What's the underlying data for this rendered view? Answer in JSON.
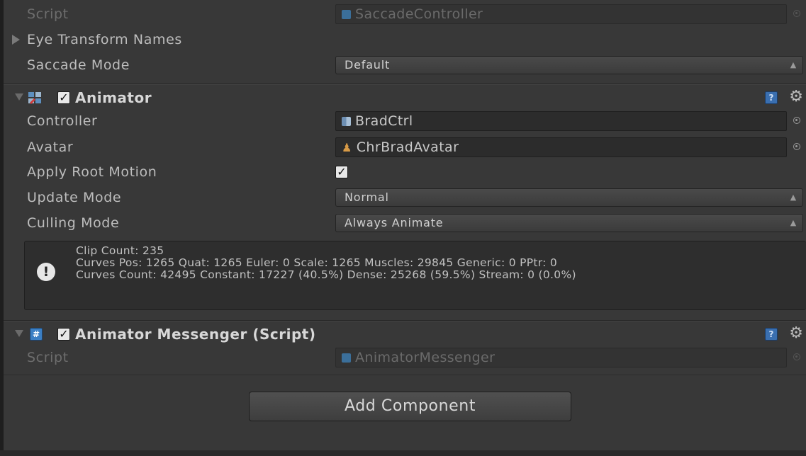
{
  "top_component": {
    "script_label": "Script",
    "script_value": "SaccadeController",
    "eye_transform_names_label": "Eye Transform Names",
    "saccade_mode_label": "Saccade Mode",
    "saccade_mode_value": "Default"
  },
  "animator": {
    "title": "Animator",
    "enabled": true,
    "controller_label": "Controller",
    "controller_value": "BradCtrl",
    "avatar_label": "Avatar",
    "avatar_value": "ChrBradAvatar",
    "apply_root_motion_label": "Apply Root Motion",
    "apply_root_motion_checked": true,
    "update_mode_label": "Update Mode",
    "update_mode_value": "Normal",
    "culling_mode_label": "Culling Mode",
    "culling_mode_value": "Always Animate",
    "info_lines": [
      "Clip Count: 235",
      "Curves Pos: 1265 Quat: 1265 Euler: 0 Scale: 1265 Muscles: 29845 Generic: 0 PPtr: 0",
      "Curves Count: 42495 Constant: 17227 (40.5%) Dense: 25268 (59.5%) Stream: 0 (0.0%)"
    ]
  },
  "messenger": {
    "title": "Animator Messenger (Script)",
    "enabled": true,
    "script_label": "Script",
    "script_value": "AnimatorMessenger"
  },
  "add_component_label": "Add Component",
  "icons": {
    "script_file": "script-file-icon",
    "controller": "animator-controller-icon",
    "avatar": "avatar-icon",
    "animator_component": "animator-component-icon",
    "csharp_script": "csharp-script-icon",
    "help": "help-icon",
    "gear": "gear-icon",
    "object_picker": "object-picker-icon",
    "info": "info-icon"
  },
  "colors": {
    "background": "#383838",
    "field_bg": "#2c2c2c",
    "help_blue": "#3a6fb0",
    "avatar_orange": "#d79a46",
    "csharp_blue": "#3b7fc4"
  }
}
